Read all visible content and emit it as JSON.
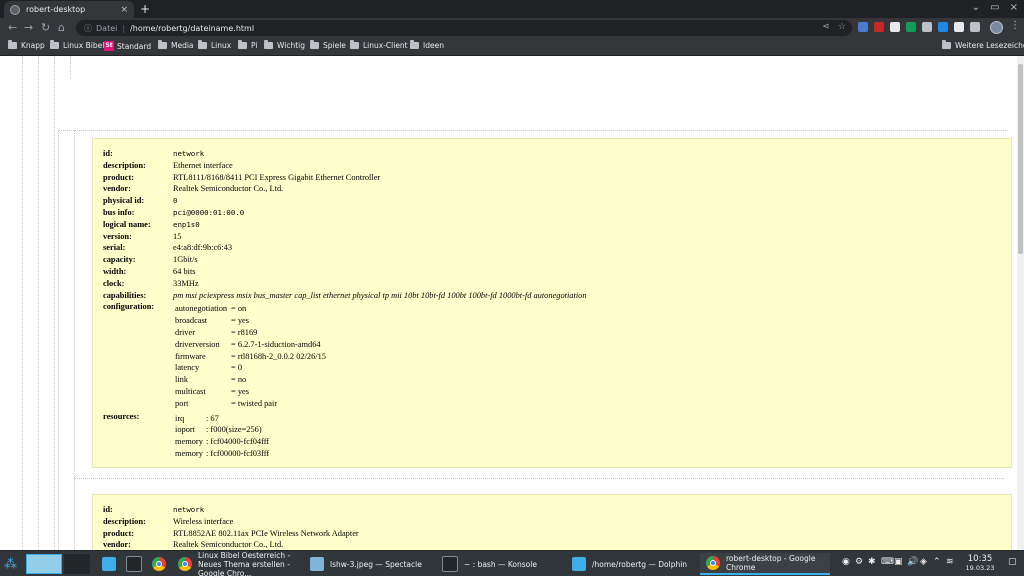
{
  "tab": {
    "title": "robert-desktop",
    "close": "×",
    "new_tab": "+"
  },
  "window_controls": {
    "minimize": "⌄",
    "maximize": "▭",
    "close": "×"
  },
  "toolbar": {
    "back": "←",
    "forward": "→",
    "reload": "↻",
    "home": "⌂"
  },
  "omnibox": {
    "info_label": "Datei",
    "url": "/home/robertg/dateiname.html",
    "share": "⋖",
    "star": "☆"
  },
  "menu_dots": "⋮",
  "extension_colors": [
    "#4a7bd0",
    "#c62828",
    "#e8eaed",
    "#0f9d58",
    "#bdc1c6",
    "#1e88e5",
    "#e8eaed",
    "#bdc1c6"
  ],
  "bookmarks": [
    {
      "label": "Knapp",
      "type": "folder"
    },
    {
      "label": "Linux Bibel",
      "type": "folder"
    },
    {
      "label": "Standard",
      "type": "st"
    },
    {
      "label": "Media",
      "type": "folder"
    },
    {
      "label": "Linux",
      "type": "folder"
    },
    {
      "label": "Pi",
      "type": "folder"
    },
    {
      "label": "Wichtig",
      "type": "folder"
    },
    {
      "label": "Spiele",
      "type": "folder"
    },
    {
      "label": "Linux-Client",
      "type": "folder"
    },
    {
      "label": "Ideen",
      "type": "folder"
    }
  ],
  "st_badge": "St",
  "other_bookmarks": "Weitere Lesezeichen",
  "node1": {
    "rows": [
      {
        "key": "id:",
        "value": "network",
        "style": "mono"
      },
      {
        "key": "description:",
        "value": "Ethernet interface",
        "style": ""
      },
      {
        "key": "product:",
        "value": "RTL8111/8168/8411 PCI Express Gigabit Ethernet Controller",
        "style": ""
      },
      {
        "key": "vendor:",
        "value": "Realtek Semiconductor Co., Ltd.",
        "style": ""
      },
      {
        "key": "physical id:",
        "value": "0",
        "style": "mono"
      },
      {
        "key": "bus info:",
        "value": "pci@0000:01:00.0",
        "style": "mono"
      },
      {
        "key": "logical name:",
        "value": "enp1s0",
        "style": "mono"
      },
      {
        "key": "version:",
        "value": "15",
        "style": ""
      },
      {
        "key": "serial:",
        "value": "e4:a8:df:9b:c6:43",
        "style": ""
      },
      {
        "key": "capacity:",
        "value": "1Gbit/s",
        "style": ""
      },
      {
        "key": "width:",
        "value": "64 bits",
        "style": ""
      },
      {
        "key": "clock:",
        "value": "33MHz",
        "style": ""
      },
      {
        "key": "capabilities:",
        "value": "pm msi pciexpress msix bus_master cap_list ethernet physical tp mii 10bt 10bt-fd 100bt 100bt-fd 1000bt-fd autonegotiation",
        "style": "it"
      }
    ],
    "configuration_label": "configuration:",
    "configuration": [
      {
        "key": "autonegotiation",
        "value": "= on"
      },
      {
        "key": "broadcast",
        "value": "= yes"
      },
      {
        "key": "driver",
        "value": "= r8169"
      },
      {
        "key": "driverversion",
        "value": "= 6.2.7-1-siduction-amd64"
      },
      {
        "key": "firmware",
        "value": "= rtl8168h-2_0.0.2 02/26/15"
      },
      {
        "key": "latency",
        "value": "= 0"
      },
      {
        "key": "link",
        "value": "= no"
      },
      {
        "key": "multicast",
        "value": "= yes"
      },
      {
        "key": "port",
        "value": "= twisted pair"
      }
    ],
    "resources_label": "resources:",
    "resources": [
      {
        "key": "irq",
        "value": ": 67"
      },
      {
        "key": "ioport",
        "value": ": f000(size=256)"
      },
      {
        "key": "memory",
        "value": ": fcf04000-fcf04fff"
      },
      {
        "key": "memory",
        "value": ": fcf00000-fcf03fff"
      }
    ]
  },
  "node2": {
    "rows": [
      {
        "key": "id:",
        "value": "network",
        "style": "mono"
      },
      {
        "key": "description:",
        "value": "Wireless interface",
        "style": ""
      },
      {
        "key": "product:",
        "value": "RTL8852AE 802.11ax PCIe Wireless Network Adapter",
        "style": ""
      },
      {
        "key": "vendor:",
        "value": "Realtek Semiconductor Co., Ltd.",
        "style": ""
      }
    ]
  },
  "taskbar": {
    "tasks": [
      {
        "label": "Linux Bibel Oesterreich - Neues Thema erstellen - Google Chro...",
        "icon": "chrome"
      },
      {
        "label": "lshw-3.jpeg — Spectacle",
        "icon": "spectacle"
      },
      {
        "label": "~ : bash — Konsole",
        "icon": "konsole"
      },
      {
        "label": "/home/robertg — Dolphin",
        "icon": "dolphin"
      },
      {
        "label": "robert-desktop - Google Chrome",
        "icon": "chrome"
      }
    ],
    "time": "10:35",
    "date": "19.03.23",
    "tray_icons": [
      "◉",
      "⚙",
      "✱",
      "⌨",
      "▣",
      "🔊",
      "◈",
      "⌃",
      "≋"
    ]
  }
}
